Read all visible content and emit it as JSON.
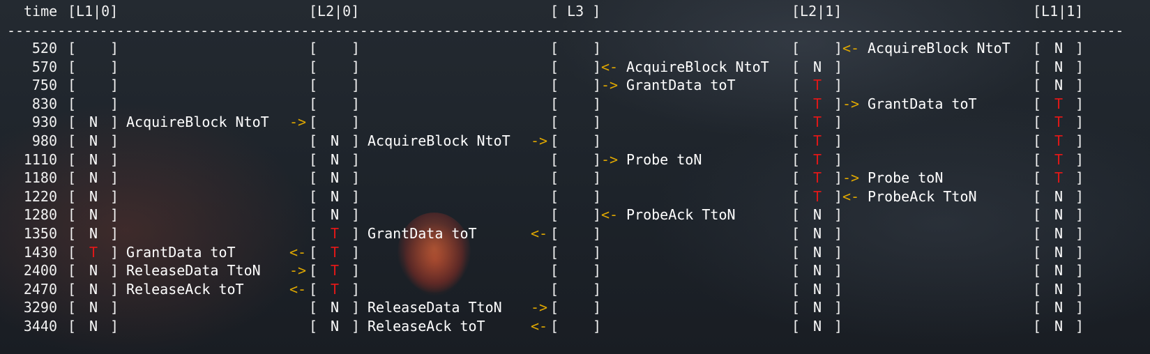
{
  "header": {
    "time": "time",
    "cols": [
      "[L1|0]",
      "[L2|0]",
      "[ L3 ]",
      "[L2|1]",
      "[L1|1]"
    ]
  },
  "rule": "--------------------------------------------------------------------------------------------------------------------------------------------------------------------",
  "colors": {
    "T": "#e01818",
    "arrow": "#e0a800",
    "text": "#f2f2f2"
  },
  "rows": [
    {
      "time": "520",
      "s": [
        "",
        "",
        "",
        "",
        ""
      ],
      "m": [
        "",
        "",
        "",
        "AcquireBlock NtoT"
      ],
      "a": [
        "",
        "",
        "",
        "<-"
      ],
      "st": [
        "",
        "",
        "",
        "",
        "N"
      ]
    },
    {
      "time": "570",
      "s": [
        "",
        "",
        "",
        "N",
        ""
      ],
      "m": [
        "",
        "",
        "AcquireBlock NtoT",
        ""
      ],
      "a": [
        "",
        "",
        "<-",
        ""
      ],
      "st": [
        "",
        "",
        "",
        "N",
        "N"
      ]
    },
    {
      "time": "750",
      "s": [
        "",
        "",
        "",
        "T",
        "N"
      ],
      "m": [
        "",
        "",
        "GrantData toT",
        ""
      ],
      "a": [
        "",
        "",
        "->",
        ""
      ],
      "st": [
        "",
        "",
        "",
        "T",
        "N"
      ]
    },
    {
      "time": "830",
      "s": [
        "",
        "",
        "",
        "T",
        "T"
      ],
      "m": [
        "",
        "",
        "",
        "GrantData toT"
      ],
      "a": [
        "",
        "",
        "",
        "->"
      ],
      "st": [
        "",
        "",
        "",
        "T",
        "T"
      ]
    },
    {
      "time": "930",
      "s": [
        "N",
        "",
        "",
        "T",
        "T"
      ],
      "m": [
        "AcquireBlock NtoT",
        "",
        "",
        ""
      ],
      "a": [
        "->",
        "",
        "",
        ""
      ],
      "st": [
        "N",
        "",
        "",
        "T",
        "T"
      ]
    },
    {
      "time": "980",
      "s": [
        "N",
        "N",
        "",
        "T",
        "T"
      ],
      "m": [
        "",
        "AcquireBlock NtoT",
        "",
        ""
      ],
      "a": [
        "",
        "->",
        "",
        ""
      ],
      "st": [
        "N",
        "N",
        "",
        "T",
        "T"
      ]
    },
    {
      "time": "1110",
      "s": [
        "N",
        "N",
        "",
        "T",
        "T"
      ],
      "m": [
        "",
        "",
        "Probe toN",
        ""
      ],
      "a": [
        "",
        "",
        "->",
        ""
      ],
      "st": [
        "N",
        "N",
        "",
        "T",
        "T"
      ]
    },
    {
      "time": "1180",
      "s": [
        "N",
        "N",
        "",
        "T",
        "T"
      ],
      "m": [
        "",
        "",
        "",
        "Probe toN"
      ],
      "a": [
        "",
        "",
        "",
        "->"
      ],
      "st": [
        "N",
        "N",
        "",
        "T",
        "T"
      ]
    },
    {
      "time": "1220",
      "s": [
        "N",
        "N",
        "",
        "T",
        "N"
      ],
      "m": [
        "",
        "",
        "",
        "ProbeAck TtoN"
      ],
      "a": [
        "",
        "",
        "",
        "<-"
      ],
      "st": [
        "N",
        "N",
        "",
        "T",
        "N"
      ]
    },
    {
      "time": "1280",
      "s": [
        "N",
        "N",
        "",
        "N",
        "N"
      ],
      "m": [
        "",
        "",
        "ProbeAck TtoN",
        ""
      ],
      "a": [
        "",
        "",
        "<-",
        ""
      ],
      "st": [
        "N",
        "N",
        "",
        "N",
        "N"
      ]
    },
    {
      "time": "1350",
      "s": [
        "N",
        "T",
        "",
        "N",
        "N"
      ],
      "m": [
        "",
        "GrantData toT",
        "",
        ""
      ],
      "a": [
        "",
        "<-",
        "",
        ""
      ],
      "st": [
        "N",
        "T",
        "",
        "N",
        "N"
      ]
    },
    {
      "time": "1430",
      "s": [
        "T",
        "T",
        "",
        "N",
        "N"
      ],
      "m": [
        "GrantData toT",
        "",
        "",
        ""
      ],
      "a": [
        "<-",
        "",
        "",
        ""
      ],
      "st": [
        "T",
        "T",
        "",
        "N",
        "N"
      ]
    },
    {
      "time": "2400",
      "s": [
        "N",
        "T",
        "",
        "N",
        "N"
      ],
      "m": [
        "ReleaseData TtoN",
        "",
        "",
        ""
      ],
      "a": [
        "->",
        "",
        "",
        ""
      ],
      "st": [
        "N",
        "T",
        "",
        "N",
        "N"
      ]
    },
    {
      "time": "2470",
      "s": [
        "N",
        "T",
        "",
        "N",
        "N"
      ],
      "m": [
        "ReleaseAck toT",
        "",
        "",
        ""
      ],
      "a": [
        "<-",
        "",
        "",
        ""
      ],
      "st": [
        "N",
        "T",
        "",
        "N",
        "N"
      ]
    },
    {
      "time": "3290",
      "s": [
        "N",
        "N",
        "",
        "N",
        "N"
      ],
      "m": [
        "",
        "ReleaseData TtoN",
        "",
        ""
      ],
      "a": [
        "",
        "->",
        "",
        ""
      ],
      "st": [
        "N",
        "N",
        "",
        "N",
        "N"
      ]
    },
    {
      "time": "3440",
      "s": [
        "N",
        "N",
        "",
        "N",
        "N"
      ],
      "m": [
        "",
        "ReleaseAck toT",
        "",
        ""
      ],
      "a": [
        "",
        "<-",
        "",
        ""
      ],
      "st": [
        "N",
        "N",
        "",
        "N",
        "N"
      ]
    }
  ]
}
